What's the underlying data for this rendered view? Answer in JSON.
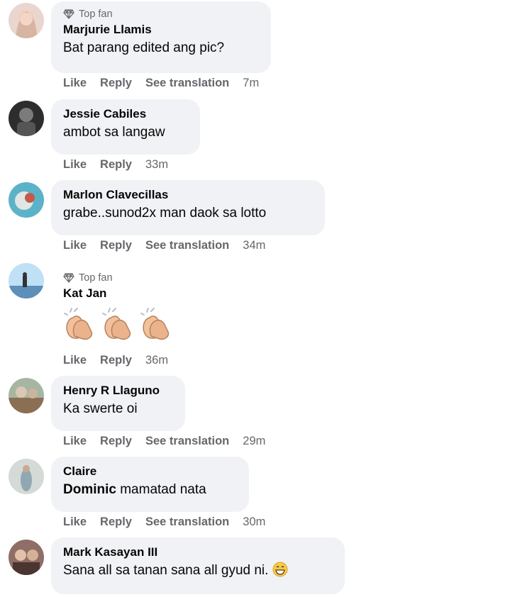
{
  "comments": [
    {
      "badge": "Top fan",
      "name": "Marjurie Llamis",
      "text": "Bat parang edited ang pic?",
      "like": "Like",
      "reply": "Reply",
      "translate": "See translation",
      "time": "7m",
      "avatar": "#d8b8b0"
    },
    {
      "name": "Jessie Cabiles",
      "text": "ambot sa langaw",
      "like": "Like",
      "reply": "Reply",
      "time": "33m",
      "avatar": "#3b3b3b"
    },
    {
      "name": "Marlon Clavecillas",
      "text": "grabe..sunod2x man daok sa lotto",
      "like": "Like",
      "reply": "Reply",
      "translate": "See translation",
      "time": "34m",
      "avatar": "#4aa3b8"
    },
    {
      "badge": "Top fan",
      "name": "Kat Jan",
      "emojis": [
        "clapping-hands",
        "clapping-hands",
        "clapping-hands"
      ],
      "like": "Like",
      "reply": "Reply",
      "time": "36m",
      "avatar": "#9cc7e6"
    },
    {
      "name": "Henry R Llaguno",
      "text": "Ka swerte oi",
      "like": "Like",
      "reply": "Reply",
      "translate": "See translation",
      "time": "29m",
      "avatar": "#8c9a86"
    },
    {
      "name": "Claire",
      "mention": "Dominic",
      "text": "mamatad nata",
      "like": "Like",
      "reply": "Reply",
      "translate": "See translation",
      "time": "30m",
      "avatar": "#b9c3bd"
    },
    {
      "name": "Mark Kasayan III",
      "text": "Sana all sa tanan sana all gyud ni.",
      "emoji": "grinning-face",
      "avatar": "#6b4a44"
    }
  ],
  "colors": {
    "bubble": "#f0f2f5",
    "secondary_text": "#65676b",
    "primary_text": "#050505"
  }
}
